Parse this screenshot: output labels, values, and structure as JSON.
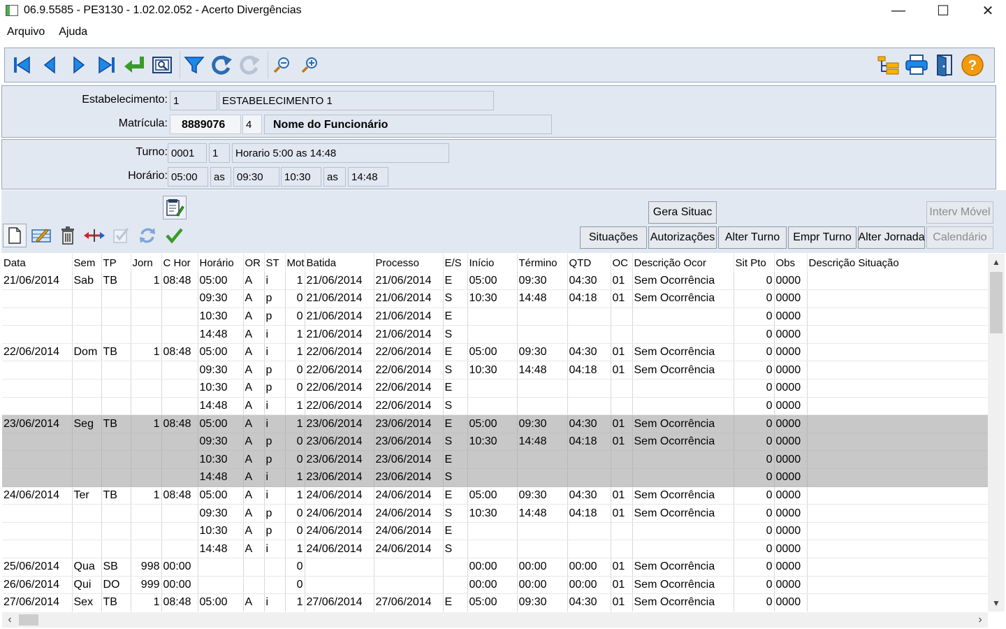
{
  "window": {
    "title": "06.9.5585 - PE3130 - 1.02.02.052 - Acerto Divergências",
    "minimize_glyph": "—",
    "maximize_glyph": "☐",
    "close_glyph": "✕"
  },
  "menu": [
    "Arquivo",
    "Ajuda"
  ],
  "toolbar": {
    "left_icons": [
      "first-record-icon",
      "previous-record-icon",
      "next-record-icon",
      "last-record-icon",
      "return-icon",
      "preview-icon",
      "filter-icon",
      "redo-icon",
      "redo-disabled-icon",
      "zoom-out-icon",
      "zoom-in-icon"
    ],
    "right_icons": [
      "tree-view-icon",
      "print-icon",
      "exit-door-icon",
      "help-icon"
    ]
  },
  "header": {
    "estabelecimento_label": "Estabelecimento:",
    "estabelecimento_code": "1",
    "estabelecimento_name": "ESTABELECIMENTO 1",
    "matricula_label": "Matrícula:",
    "matricula_value": "8889076",
    "matricula_digit": "4",
    "funcionario_name": "Nome do Funcionário",
    "turno_label": "Turno:",
    "turno_code": "0001",
    "turno_seq": "1",
    "turno_desc": "Horario 5:00 as 14:48",
    "horario_label": "Horário:",
    "horario_1": "05:00",
    "horario_as_1": "as",
    "horario_2": "09:30",
    "horario_3": "10:30",
    "horario_as_2": "as",
    "horario_4": "14:48"
  },
  "actions": {
    "gera_situac": "Gera Situac",
    "interv_movel": "Interv Móvel",
    "situacoes": "Situações",
    "autorizacoes": "Autorizações",
    "alter_turno": "Alter Turno",
    "empr_turno": "Empr Turno",
    "alter_jornada": "Alter Jornada",
    "calendario": "Calendário"
  },
  "grid": {
    "columns": [
      "Data",
      "Sem",
      "TP",
      "Jorn",
      "C Hor",
      "Horário",
      "OR",
      "ST",
      "Mot",
      "Batida",
      "Processo",
      "E/S",
      "Início",
      "Término",
      "QTD",
      "OC",
      "Descrição Ocor",
      "Sit Pto",
      "Obs",
      "Descrição Situação"
    ],
    "rows": [
      [
        "21/06/2014",
        "Sab",
        "TB",
        "1",
        "08:48",
        "05:00",
        "A",
        "i",
        "1",
        "21/06/2014",
        "21/06/2014",
        "E",
        "05:00",
        "09:30",
        "04:30",
        "01",
        "Sem Ocorrência",
        "0",
        "0000",
        ""
      ],
      [
        "",
        "",
        "",
        "",
        "",
        "09:30",
        "A",
        "p",
        "0",
        "21/06/2014",
        "21/06/2014",
        "S",
        "10:30",
        "14:48",
        "04:18",
        "01",
        "Sem Ocorrência",
        "0",
        "0000",
        ""
      ],
      [
        "",
        "",
        "",
        "",
        "",
        "10:30",
        "A",
        "p",
        "0",
        "21/06/2014",
        "21/06/2014",
        "E",
        "",
        "",
        "",
        "",
        "",
        "0",
        "0000",
        ""
      ],
      [
        "",
        "",
        "",
        "",
        "",
        "14:48",
        "A",
        "i",
        "1",
        "21/06/2014",
        "21/06/2014",
        "S",
        "",
        "",
        "",
        "",
        "",
        "0",
        "0000",
        ""
      ],
      [
        "22/06/2014",
        "Dom",
        "TB",
        "1",
        "08:48",
        "05:00",
        "A",
        "i",
        "1",
        "22/06/2014",
        "22/06/2014",
        "E",
        "05:00",
        "09:30",
        "04:30",
        "01",
        "Sem Ocorrência",
        "0",
        "0000",
        ""
      ],
      [
        "",
        "",
        "",
        "",
        "",
        "09:30",
        "A",
        "p",
        "0",
        "22/06/2014",
        "22/06/2014",
        "S",
        "10:30",
        "14:48",
        "04:18",
        "01",
        "Sem Ocorrência",
        "0",
        "0000",
        ""
      ],
      [
        "",
        "",
        "",
        "",
        "",
        "10:30",
        "A",
        "p",
        "0",
        "22/06/2014",
        "22/06/2014",
        "E",
        "",
        "",
        "",
        "",
        "",
        "0",
        "0000",
        ""
      ],
      [
        "",
        "",
        "",
        "",
        "",
        "14:48",
        "A",
        "i",
        "1",
        "22/06/2014",
        "22/06/2014",
        "S",
        "",
        "",
        "",
        "",
        "",
        "0",
        "0000",
        ""
      ],
      [
        "23/06/2014",
        "Seg",
        "TB",
        "1",
        "08:48",
        "05:00",
        "A",
        "i",
        "1",
        "23/06/2014",
        "23/06/2014",
        "E",
        "05:00",
        "09:30",
        "04:30",
        "01",
        "Sem Ocorrência",
        "0",
        "0000",
        ""
      ],
      [
        "",
        "",
        "",
        "",
        "",
        "09:30",
        "A",
        "p",
        "0",
        "23/06/2014",
        "23/06/2014",
        "S",
        "10:30",
        "14:48",
        "04:18",
        "01",
        "Sem Ocorrência",
        "0",
        "0000",
        ""
      ],
      [
        "",
        "",
        "",
        "",
        "",
        "10:30",
        "A",
        "p",
        "0",
        "23/06/2014",
        "23/06/2014",
        "E",
        "",
        "",
        "",
        "",
        "",
        "0",
        "0000",
        ""
      ],
      [
        "",
        "",
        "",
        "",
        "",
        "14:48",
        "A",
        "i",
        "1",
        "23/06/2014",
        "23/06/2014",
        "S",
        "",
        "",
        "",
        "",
        "",
        "0",
        "0000",
        ""
      ],
      [
        "24/06/2014",
        "Ter",
        "TB",
        "1",
        "08:48",
        "05:00",
        "A",
        "i",
        "1",
        "24/06/2014",
        "24/06/2014",
        "E",
        "05:00",
        "09:30",
        "04:30",
        "01",
        "Sem Ocorrência",
        "0",
        "0000",
        ""
      ],
      [
        "",
        "",
        "",
        "",
        "",
        "09:30",
        "A",
        "p",
        "0",
        "24/06/2014",
        "24/06/2014",
        "S",
        "10:30",
        "14:48",
        "04:18",
        "01",
        "Sem Ocorrência",
        "0",
        "0000",
        ""
      ],
      [
        "",
        "",
        "",
        "",
        "",
        "10:30",
        "A",
        "p",
        "0",
        "24/06/2014",
        "24/06/2014",
        "E",
        "",
        "",
        "",
        "",
        "",
        "0",
        "0000",
        ""
      ],
      [
        "",
        "",
        "",
        "",
        "",
        "14:48",
        "A",
        "i",
        "1",
        "24/06/2014",
        "24/06/2014",
        "S",
        "",
        "",
        "",
        "",
        "",
        "0",
        "0000",
        ""
      ],
      [
        "25/06/2014",
        "Qua",
        "SB",
        "998",
        "00:00",
        "",
        "",
        "",
        "0",
        "",
        "",
        "",
        "00:00",
        "00:00",
        "00:00",
        "01",
        "Sem Ocorrência",
        "0",
        "0000",
        ""
      ],
      [
        "26/06/2014",
        "Qui",
        "DO",
        "999",
        "00:00",
        "",
        "",
        "",
        "0",
        "",
        "",
        "",
        "00:00",
        "00:00",
        "00:00",
        "01",
        "Sem Ocorrência",
        "0",
        "0000",
        ""
      ],
      [
        "27/06/2014",
        "Sex",
        "TB",
        "1",
        "08:48",
        "05:00",
        "A",
        "i",
        "1",
        "27/06/2014",
        "27/06/2014",
        "E",
        "05:00",
        "09:30",
        "04:30",
        "01",
        "Sem Ocorrência",
        "0",
        "0000",
        ""
      ]
    ],
    "selected_rows": [
      8,
      9,
      10,
      11
    ]
  },
  "colors": {
    "panel_bg": "#e2e8f2",
    "selected_row": "#c8c8c8",
    "nav_blue": "#1565c0",
    "return_green": "#3a9b2a",
    "help_orange": "#f29a0e"
  }
}
